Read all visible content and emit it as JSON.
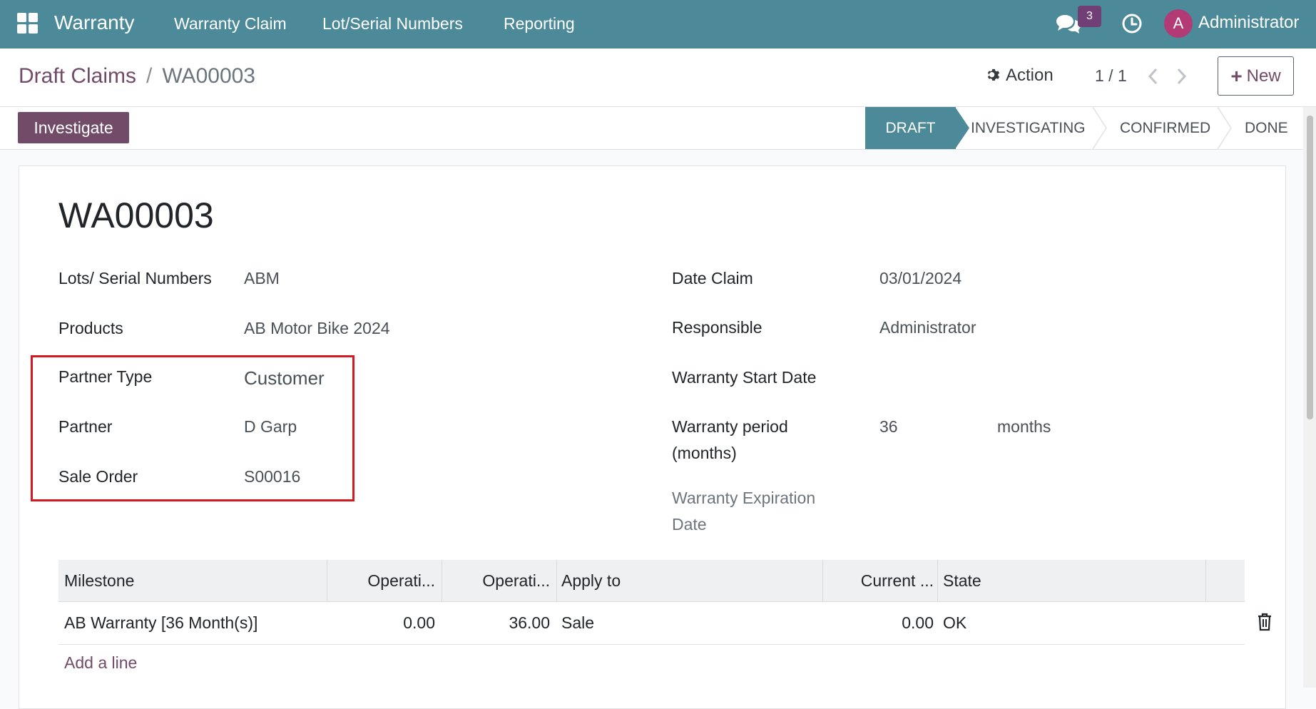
{
  "navbar": {
    "app_name": "Warranty",
    "menu": [
      "Warranty Claim",
      "Lot/Serial Numbers",
      "Reporting"
    ],
    "message_count": "3",
    "user_initial": "A",
    "user_name": "Administrator"
  },
  "control_panel": {
    "breadcrumb_parent": "Draft Claims",
    "breadcrumb_separator": "/",
    "breadcrumb_current": "WA00003",
    "action_label": "Action",
    "pager": "1 / 1",
    "new_label": "New"
  },
  "statusbar": {
    "button_label": "Investigate",
    "stages": [
      "DRAFT",
      "INVESTIGATING",
      "CONFIRMED",
      "DONE"
    ],
    "active_stage": "DRAFT"
  },
  "form": {
    "title": "WA00003",
    "left": {
      "lots_label": "Lots/ Serial Numbers",
      "lots_value": "ABM",
      "products_label": "Products",
      "products_value": "AB Motor Bike 2024",
      "partner_type_label": "Partner Type",
      "partner_type_value": "Customer",
      "partner_label": "Partner",
      "partner_value": "D Garp",
      "sale_order_label": "Sale Order",
      "sale_order_value": "S00016"
    },
    "right": {
      "date_claim_label": "Date Claim",
      "date_claim_value": "03/01/2024",
      "responsible_label": "Responsible",
      "responsible_value": "Administrator",
      "start_date_label": "Warranty Start Date",
      "period_label_1": "Warranty period",
      "period_label_2": "(months)",
      "period_value": "36",
      "period_unit": "months",
      "expiration_label_1": "Warranty Expiration",
      "expiration_label_2": "Date"
    }
  },
  "milestones": {
    "columns": [
      "Milestone",
      "Operati...",
      "Operati...",
      "Apply to",
      "Current ...",
      "State"
    ],
    "rows": [
      {
        "milestone": "AB Warranty [36 Month(s)]",
        "op1": "0.00",
        "op2": "36.00",
        "apply_to": "Sale",
        "current": "0.00",
        "state": "OK"
      }
    ],
    "add_line_label": "Add a line"
  },
  "colors": {
    "navbar": "#4c8a9a",
    "primary": "#714b67",
    "highlight": "#d31a20"
  }
}
